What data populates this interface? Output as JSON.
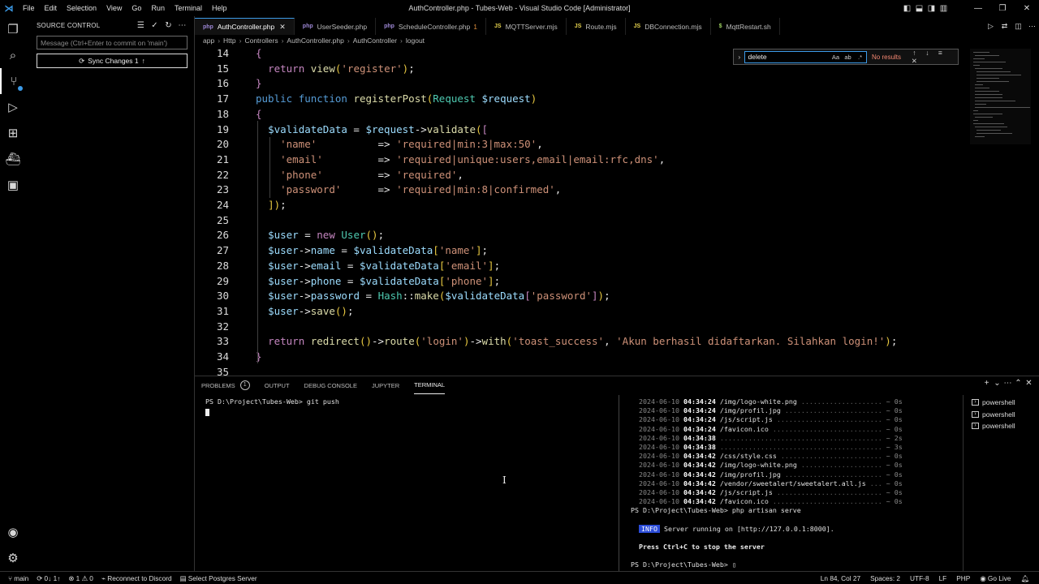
{
  "titlebar": {
    "menu": [
      "File",
      "Edit",
      "Selection",
      "View",
      "Go",
      "Run",
      "Terminal",
      "Help"
    ],
    "title": "AuthController.php - Tubes-Web - Visual Studio Code [Administrator]"
  },
  "activity_bar": [
    "explorer-icon",
    "search-icon",
    "source-control-icon",
    "run-debug-icon",
    "extensions-icon",
    "docker-icon",
    "remote-icon",
    "accounts-icon",
    "manage-icon"
  ],
  "sidebar": {
    "header": "SOURCE CONTROL",
    "commit_placeholder": "Message (Ctrl+Enter to commit on 'main')",
    "sync_label": "Sync Changes 1"
  },
  "tabs": [
    {
      "icon": "php",
      "label": "AuthController.php",
      "active": true
    },
    {
      "icon": "php",
      "label": "UserSeeder.php"
    },
    {
      "icon": "php",
      "label": "ScheduleController.php",
      "mod": "1"
    },
    {
      "icon": "JS",
      "label": "MQTTServer.mjs"
    },
    {
      "icon": "JS",
      "label": "Route.mjs"
    },
    {
      "icon": "JS",
      "label": "DBConnection.mjs"
    },
    {
      "icon": "$",
      "label": "MqttRestart.sh"
    }
  ],
  "breadcrumb": [
    "app",
    "Http",
    "Controllers",
    "AuthController.php",
    "AuthController",
    "logout"
  ],
  "find": {
    "query": "delete",
    "result": "No results"
  },
  "code_lines": [
    {
      "n": "14",
      "t": "{"
    },
    {
      "n": "15",
      "t": "  return view('register');"
    },
    {
      "n": "16",
      "t": "}"
    },
    {
      "n": "17",
      "t": "public function registerPost(Request $request)"
    },
    {
      "n": "18",
      "t": "{"
    },
    {
      "n": "19",
      "t": "  $validateData = $request->validate(["
    },
    {
      "n": "20",
      "t": "    'name'          => 'required|min:3|max:50',"
    },
    {
      "n": "21",
      "t": "    'email'         => 'required|unique:users,email|email:rfc,dns',"
    },
    {
      "n": "22",
      "t": "    'phone'         => 'required',"
    },
    {
      "n": "23",
      "t": "    'password'      => 'required|min:8|confirmed',"
    },
    {
      "n": "24",
      "t": "  ]);"
    },
    {
      "n": "25",
      "t": ""
    },
    {
      "n": "26",
      "t": "  $user = new User();"
    },
    {
      "n": "27",
      "t": "  $user->name = $validateData['name'];"
    },
    {
      "n": "28",
      "t": "  $user->email = $validateData['email'];"
    },
    {
      "n": "29",
      "t": "  $user->phone = $validateData['phone'];"
    },
    {
      "n": "30",
      "t": "  $user->password = Hash::make($validateData['password']);"
    },
    {
      "n": "31",
      "t": "  $user->save();"
    },
    {
      "n": "32",
      "t": ""
    },
    {
      "n": "33",
      "t": "  return redirect()->route('login')->with('toast_success', 'Akun berhasil didaftarkan. Silahkan login!');"
    },
    {
      "n": "34",
      "t": "}"
    },
    {
      "n": "35",
      "t": ""
    }
  ],
  "panel": {
    "tabs": [
      "PROBLEMS",
      "OUTPUT",
      "DEBUG CONSOLE",
      "JUPYTER",
      "TERMINAL"
    ],
    "problems_count": "1",
    "terminal1": "PS D:\\Project\\Tubes-Web> git push",
    "serve_log": [
      {
        "date": "2024-06-10",
        "time": "04:34:24",
        "path": "/img/logo-white.png",
        "dur": "~ 0s"
      },
      {
        "date": "2024-06-10",
        "time": "04:34:24",
        "path": "/img/profil.jpg",
        "dur": "~ 0s"
      },
      {
        "date": "2024-06-10",
        "time": "04:34:24",
        "path": "/js/script.js",
        "dur": "~ 0s"
      },
      {
        "date": "2024-06-10",
        "time": "04:34:24",
        "path": "/favicon.ico",
        "dur": "~ 0s"
      },
      {
        "date": "2024-06-10",
        "time": "04:34:38",
        "path": "",
        "dur": "~ 2s"
      },
      {
        "date": "2024-06-10",
        "time": "04:34:38",
        "path": "",
        "dur": "~ 3s"
      },
      {
        "date": "2024-06-10",
        "time": "04:34:42",
        "path": "/css/style.css",
        "dur": "~ 0s"
      },
      {
        "date": "2024-06-10",
        "time": "04:34:42",
        "path": "/img/logo-white.png",
        "dur": "~ 0s"
      },
      {
        "date": "2024-06-10",
        "time": "04:34:42",
        "path": "/img/profil.jpg",
        "dur": "~ 0s"
      },
      {
        "date": "2024-06-10",
        "time": "04:34:42",
        "path": "/vendor/sweetalert/sweetalert.all.js",
        "dur": "~ 0s"
      },
      {
        "date": "2024-06-10",
        "time": "04:34:42",
        "path": "/js/script.js",
        "dur": "~ 0s"
      },
      {
        "date": "2024-06-10",
        "time": "04:34:42",
        "path": "/favicon.ico",
        "dur": "~ 0s"
      }
    ],
    "serve_cmd": "PS D:\\Project\\Tubes-Web> php artisan serve",
    "info_label": "INFO",
    "info_text": "Server running on [http://127.0.0.1:8000].",
    "stop_hint": "Press Ctrl+C to stop the server",
    "last_prompt": "PS D:\\Project\\Tubes-Web> ",
    "terminals": [
      "powershell",
      "powershell",
      "powershell"
    ]
  },
  "statusbar": {
    "branch": "main",
    "sync": "0↓ 1↑",
    "errors": "⊗ 1 ⚠ 0",
    "discord": "Reconnect to Discord",
    "db": "Select Postgres Server",
    "position": "Ln 84, Col 27",
    "spaces": "Spaces: 2",
    "encoding": "UTF-8",
    "eol": "LF",
    "language": "PHP",
    "golive": "Go Live"
  }
}
